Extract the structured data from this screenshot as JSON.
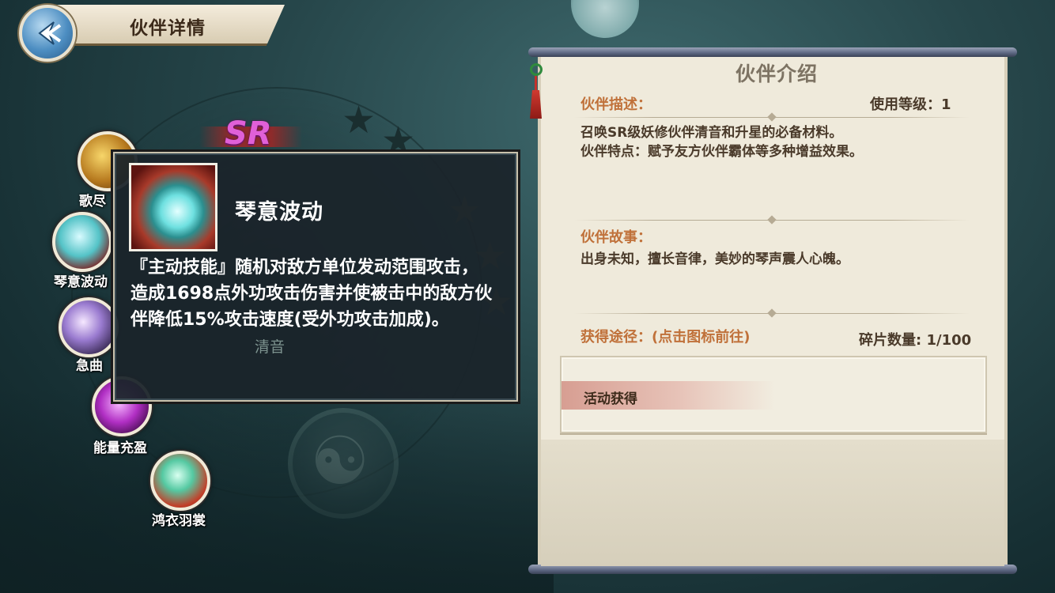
{
  "header": {
    "title": "伙伴详情",
    "back_icon": "back-arrow-icon"
  },
  "partner": {
    "rarity": "SR",
    "name_faded": "清音"
  },
  "skills": [
    {
      "label": "歌尽",
      "icon": "skill-song-icon"
    },
    {
      "label": "琴意波动",
      "icon": "skill-qin-wave-icon"
    },
    {
      "label": "急曲",
      "icon": "skill-rapid-tune-icon"
    },
    {
      "label": "能量充盈",
      "icon": "skill-energy-icon"
    },
    {
      "label": "鸿衣羽裳",
      "icon": "skill-feather-robe-icon"
    }
  ],
  "tooltip": {
    "skill_name": "琴意波动",
    "description": "『主动技能』随机对敌方单位发动范围攻击，造成1698点外功攻击伤害并使被击中的敌方伙伴降低15%攻击速度(受外功攻击加成)。"
  },
  "panel": {
    "title": "伙伴介绍",
    "desc_label": "伙伴描述：",
    "level_req": "使用等级：1",
    "desc_line1": "召唤SR级妖修伙伴清音和升星的必备材料。",
    "desc_line2": "伙伴特点：赋予友方伙伴霸体等多种增益效果。",
    "story_label": "伙伴故事：",
    "story_text": "出身未知，擅长音律，美妙的琴声震人心魄。",
    "source_label": "获得途径：(点击图标前往)",
    "fragment_count": "碎片数量: 1/100",
    "sources": [
      "活动获得"
    ]
  }
}
